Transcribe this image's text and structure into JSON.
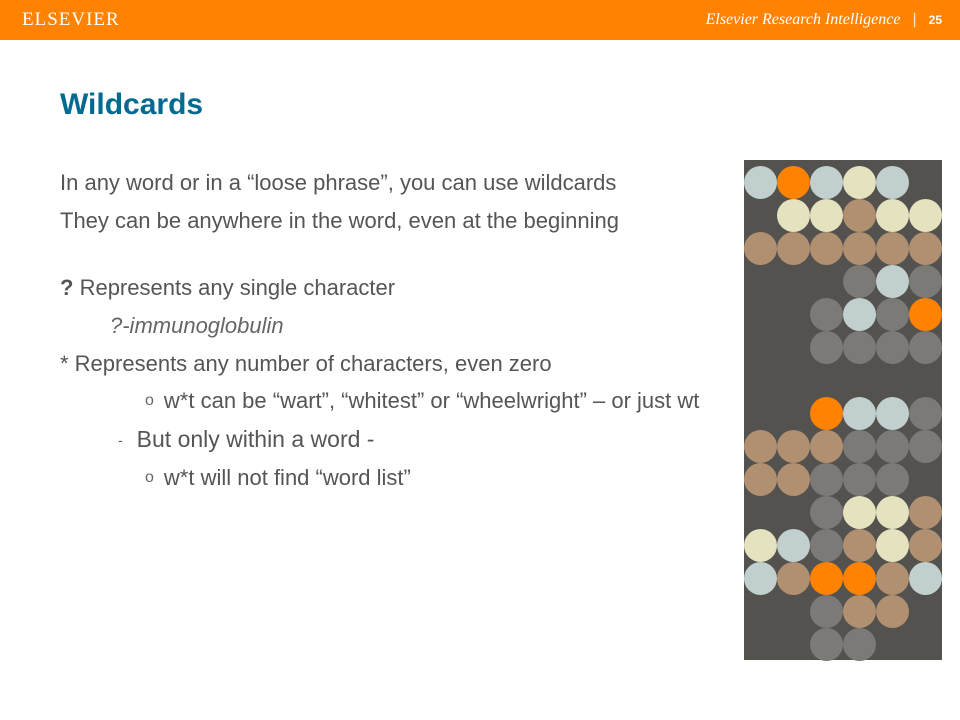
{
  "header": {
    "logo": "ELSEVIER",
    "subtitle": "Elsevier Research Intelligence",
    "page_number": "25"
  },
  "title": "Wildcards",
  "body": {
    "p1": "In any word or in a “loose phrase”, you can use wildcards",
    "p2": "They can be anywhere in the word, even at the beginning",
    "p3_prefix": "?",
    "p3_rest": " Represents any single character",
    "p4": "?-immunoglobulin",
    "p5": "* Represents any number of characters, even zero",
    "p6": "w*t can be “wart”, “whitest” or “wheelwright” – or just wt",
    "p7": "But only within a word -",
    "p8": "w*t will not find “word list”"
  },
  "bullets": {
    "circle": "o",
    "dash": "-"
  },
  "dots": [
    [
      "lightblue",
      "orange",
      "lightblue",
      "cream",
      "lightblue",
      "none"
    ],
    [
      "none",
      "cream",
      "cream",
      "tan",
      "cream",
      "cream"
    ],
    [
      "tan",
      "tan",
      "tan",
      "tan",
      "tan",
      "tan"
    ],
    [
      "none",
      "none",
      "none",
      "gray",
      "lightblue",
      "gray"
    ],
    [
      "none",
      "none",
      "gray",
      "lightblue",
      "gray",
      "orange"
    ],
    [
      "none",
      "none",
      "gray",
      "gray",
      "gray",
      "gray"
    ],
    [
      "none",
      "none",
      "none",
      "none",
      "none",
      "none"
    ],
    [
      "none",
      "none",
      "orange",
      "lightblue",
      "lightblue",
      "gray"
    ],
    [
      "tan",
      "tan",
      "tan",
      "gray",
      "gray",
      "gray"
    ],
    [
      "tan",
      "tan",
      "gray",
      "gray",
      "gray",
      "none"
    ],
    [
      "none",
      "none",
      "gray",
      "cream",
      "cream",
      "tan"
    ],
    [
      "cream",
      "lightblue",
      "gray",
      "tan",
      "cream",
      "tan"
    ],
    [
      "lightblue",
      "tan",
      "orange",
      "orange",
      "tan",
      "lightblue"
    ],
    [
      "none",
      "none",
      "gray",
      "tan",
      "tan",
      "none"
    ],
    [
      "none",
      "none",
      "gray",
      "gray",
      "none",
      "none"
    ]
  ]
}
